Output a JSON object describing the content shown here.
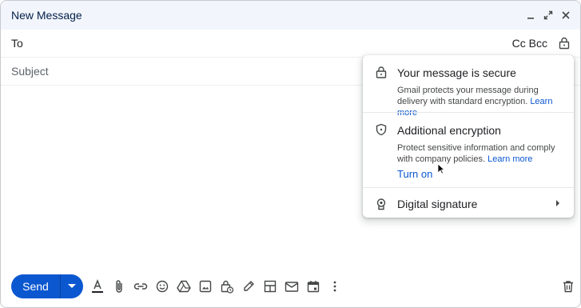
{
  "window": {
    "title": "New Message"
  },
  "to_row": {
    "label": "To",
    "cc_bcc": "Cc Bcc"
  },
  "subject_row": {
    "placeholder": "Subject"
  },
  "security_panel": {
    "secure": {
      "heading": "Your message is secure",
      "body": "Gmail protects your message during delivery with standard encryption.",
      "link": "Learn more"
    },
    "additional": {
      "heading": "Additional encryption",
      "body": "Protect sensitive information and comply with company policies.",
      "link": "Learn more",
      "action": "Turn on"
    },
    "signature": {
      "heading": "Digital signature"
    }
  },
  "toolbar": {
    "send_label": "Send",
    "icons": [
      "text-format-icon",
      "attach-icon",
      "link-icon",
      "emoji-icon",
      "drive-icon",
      "photo-icon",
      "confidential-mode-icon",
      "signature-icon",
      "layouts-icon",
      "template-icon",
      "schedule-icon",
      "more-options-icon"
    ],
    "trash_icon": "trash-icon"
  },
  "colors": {
    "accent": "#0b57d0",
    "titlebar_bg": "#f2f6fc",
    "title_text": "#041e49"
  }
}
